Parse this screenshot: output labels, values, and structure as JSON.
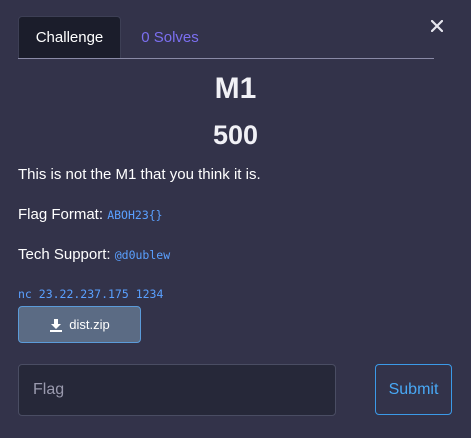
{
  "tabs": [
    {
      "label": "Challenge",
      "active": true
    },
    {
      "label": "0 Solves",
      "active": false
    }
  ],
  "close_icon": "close-icon",
  "challenge": {
    "name": "M1",
    "value": "500",
    "description": "This is not the M1 that you think it is.",
    "flag_format_label": "Flag Format:",
    "flag_format_value": "ABOH23{}",
    "tech_support_label": "Tech Support:",
    "tech_support_value": "@d0ublew",
    "connection": "nc 23.22.237.175 1234"
  },
  "files": [
    {
      "label": "dist.zip",
      "icon": "download-icon"
    }
  ],
  "form": {
    "flag_placeholder": "Flag",
    "flag_value": "",
    "submit_label": "Submit"
  },
  "colors": {
    "background": "#33334a",
    "active_tab": "#1b1d2b",
    "inactive_tab_text": "#7b6ff0",
    "code_text": "#5aa0ff",
    "submit_border": "#3b9ae8"
  }
}
